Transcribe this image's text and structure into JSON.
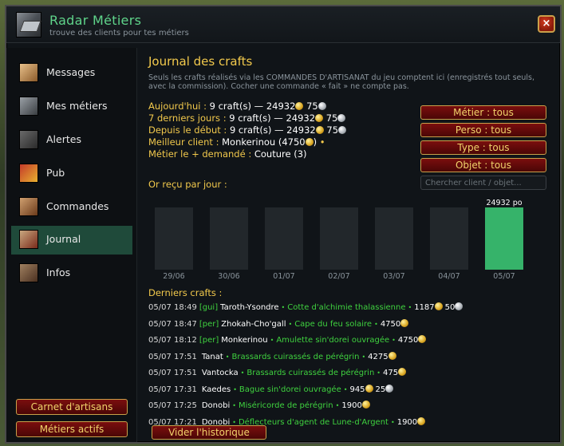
{
  "window": {
    "title": "Radar Métiers",
    "subtitle": "trouve des clients pour tes métiers",
    "close_label": "×"
  },
  "sidebar": {
    "items": [
      {
        "label": "Messages",
        "icon": "envelope-icon"
      },
      {
        "label": "Mes métiers",
        "icon": "anvil-icon"
      },
      {
        "label": "Alertes",
        "icon": "bell-icon"
      },
      {
        "label": "Pub",
        "icon": "megaphone-icon"
      },
      {
        "label": "Commandes",
        "icon": "order-icon"
      },
      {
        "label": "Journal",
        "icon": "journal-icon"
      },
      {
        "label": "Infos",
        "icon": "book-icon"
      }
    ],
    "active_index": 5,
    "buttons": {
      "carnet": "Carnet d'artisans",
      "metiers_actifs": "Métiers actifs"
    }
  },
  "journal": {
    "title": "Journal des crafts",
    "description": "Seuls les crafts réalisés via les COMMANDES D'ARTISANAT du jeu comptent ici (enregistrés tout seuls, avec la commission). Cocher une commande « fait » ne compte pas.",
    "stats": {
      "today_label": "Aujourd'hui :",
      "today_count": "9 craft(s)",
      "today_gold": "24932",
      "today_silver": "75",
      "week_label": "7 derniers jours :",
      "week_count": "9 craft(s)",
      "week_gold": "24932",
      "week_silver": "75",
      "all_label": "Depuis le début :",
      "all_count": "9 craft(s)",
      "all_gold": "24932",
      "all_silver": "75",
      "best_client_label": "Meilleur client :",
      "best_client_name": "Monkerinou",
      "best_client_amount": "(4750",
      "best_client_close": ")",
      "bullet": "•",
      "best_prof_label": "Métier le + demandé :",
      "best_prof_value": "Couture (3)",
      "dash": "—"
    },
    "filters": {
      "metier": "Métier : tous",
      "perso": "Perso : tous",
      "type": "Type : tous",
      "objet": "Objet : tous",
      "search_placeholder": "Chercher client / objet..."
    },
    "chart_label": "Or reçu par jour :",
    "recent_label": "Derniers crafts :",
    "clear_button": "Vider l'historique"
  },
  "chart_data": {
    "type": "bar",
    "categories": [
      "29/06",
      "30/06",
      "01/07",
      "02/07",
      "03/07",
      "04/07",
      "05/07"
    ],
    "values": [
      0,
      0,
      0,
      0,
      0,
      0,
      24932
    ],
    "value_labels": [
      "",
      "",
      "",
      "",
      "",
      "",
      "24932 po"
    ],
    "title": "Or reçu par jour :",
    "ylim": [
      0,
      24932
    ],
    "bar_color": "#36b36a",
    "empty_bar_color": "#22272b"
  },
  "crafts": [
    {
      "time": "05/07 18:49",
      "guild": "[gui]",
      "name": "Taroth-Ysondre",
      "item": "Cotte d'alchimie thalassienne",
      "gold": "1187",
      "silver": "50"
    },
    {
      "time": "05/07 18:47",
      "guild": "[per]",
      "name": "Zhokah-Cho'gall",
      "item": "Cape du feu solaire",
      "gold": "4750",
      "silver": ""
    },
    {
      "time": "05/07 18:12",
      "guild": "[per]",
      "name": "Monkerinou",
      "item": "Amulette sin'dorei ouvragée",
      "gold": "4750",
      "silver": ""
    },
    {
      "time": "05/07 17:51",
      "guild": "",
      "name": "Tanat",
      "item": "Brassards cuirassés de pérégrin",
      "gold": "4275",
      "silver": ""
    },
    {
      "time": "05/07 17:51",
      "guild": "",
      "name": "Vantocka",
      "item": "Brassards cuirassés de pérégrin",
      "gold": "475",
      "silver": ""
    },
    {
      "time": "05/07 17:31",
      "guild": "",
      "name": "Kaedes",
      "item": "Bague sin'dorei ouvragée",
      "gold": "945",
      "silver": "25"
    },
    {
      "time": "05/07 17:25",
      "guild": "",
      "name": "Donobi",
      "item": "Miséricorde de pérégrin",
      "gold": "1900",
      "silver": ""
    },
    {
      "time": "05/07 17:21",
      "guild": "",
      "name": "Donobi",
      "item": "Déflecteurs d'agent de Lune-d'Argent",
      "gold": "1900",
      "silver": ""
    }
  ],
  "colors": {
    "accent_green": "#5fd48a",
    "gold_text": "#f2c94c",
    "item_green": "#3fd23f",
    "button_red": "#7a0e0e"
  }
}
